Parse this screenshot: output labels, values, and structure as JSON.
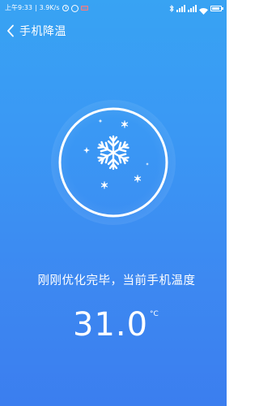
{
  "status_bar": {
    "time": "上午9:33",
    "separator": "|",
    "network_speed": "3.9K/s",
    "icons": [
      "clock-icon",
      "alarm-icon",
      "mail-icon",
      "bluetooth-icon",
      "signal-icon",
      "signal-icon",
      "wifi-icon",
      "battery-icon"
    ]
  },
  "header": {
    "back_icon": "chevron-left-icon",
    "title": "手机降温"
  },
  "badge": {
    "icon": "snowflake-icon"
  },
  "result": {
    "message": "刚刚优化完毕，当前手机温度",
    "temperature": "31.0",
    "unit": "°C"
  },
  "colors": {
    "background_top": "#38a3f3",
    "background_bottom": "#3b7eef",
    "foreground": "#ffffff"
  }
}
